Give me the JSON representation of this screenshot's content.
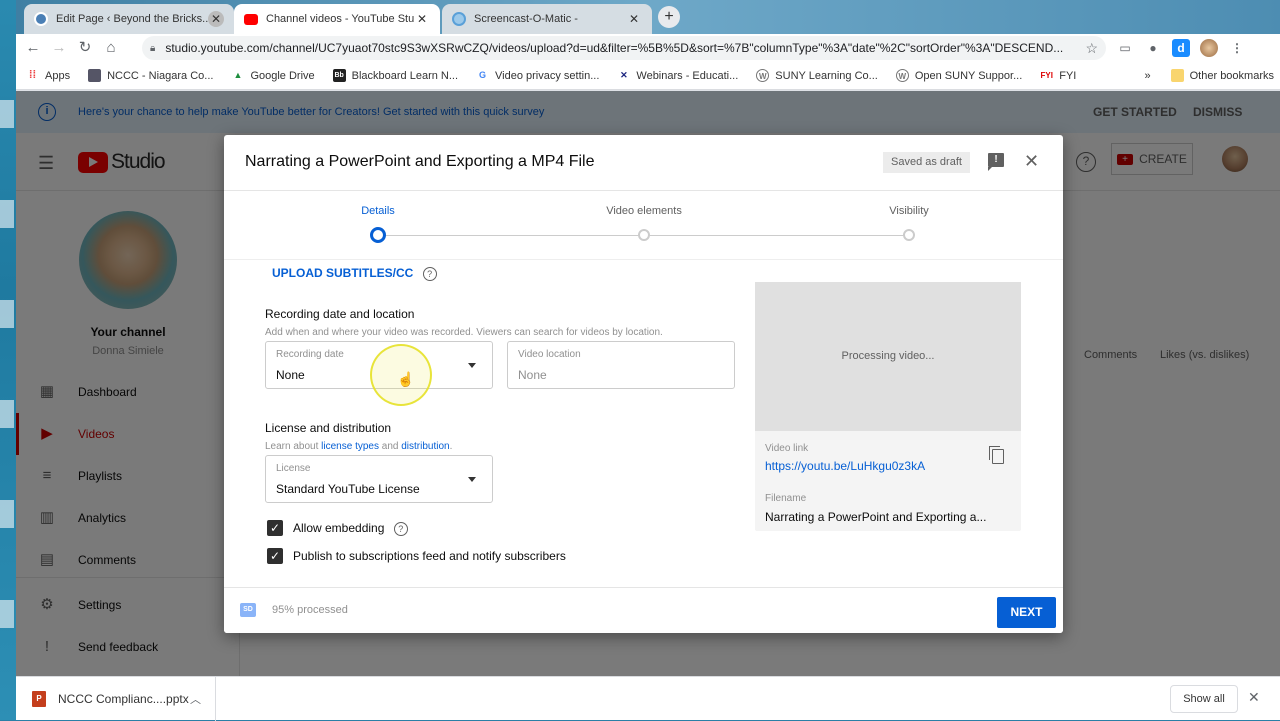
{
  "browser": {
    "tabs": [
      {
        "label": "Edit Page ‹ Beyond the Bricks... N",
        "icon": "wordpress-icon",
        "active": false
      },
      {
        "label": "Channel videos - YouTube Studio",
        "icon": "youtube-icon",
        "active": true
      },
      {
        "label": "Screencast-O-Matic -",
        "icon": "screencast-icon",
        "active": false
      }
    ],
    "url": "studio.youtube.com/channel/UC7yuaot70stc9S3wXSRwCZQ/videos/upload?d=ud&filter=%5B%5D&sort=%7B\"columnType\"%3A\"date\"%2C\"sortOrder\"%3A\"DESCEND...",
    "bookmarks": [
      {
        "label": "Apps",
        "icon": "apps-grid-icon"
      },
      {
        "label": "NCCC - Niagara Co...",
        "icon": "nccc-icon"
      },
      {
        "label": "Google Drive",
        "icon": "google-drive-icon"
      },
      {
        "label": "Blackboard Learn N...",
        "icon": "blackboard-icon"
      },
      {
        "label": "Video privacy settin...",
        "icon": "google-icon"
      },
      {
        "label": "Webinars - Educati...",
        "icon": "webinars-icon"
      },
      {
        "label": "SUNY Learning Co...",
        "icon": "wordpress-icon"
      },
      {
        "label": "Open SUNY Suppor...",
        "icon": "wordpress-icon"
      },
      {
        "label": "FYI",
        "icon": "fyi-icon"
      }
    ],
    "other_bookmarks": "Other bookmarks",
    "overflow": "»"
  },
  "banner": {
    "text": "Here's your chance to help make YouTube better for Creators! Get started with this quick survey",
    "get_started": "GET STARTED",
    "dismiss": "DISMISS"
  },
  "header": {
    "logo_text": "Studio",
    "create_label": "CREATE"
  },
  "sidebar": {
    "channel_title": "Your channel",
    "channel_name": "Donna Simiele",
    "items": [
      {
        "label": "Dashboard",
        "icon": "dashboard-icon",
        "active": false
      },
      {
        "label": "Videos",
        "icon": "videos-icon",
        "active": true
      },
      {
        "label": "Playlists",
        "icon": "playlists-icon",
        "active": false
      },
      {
        "label": "Analytics",
        "icon": "analytics-icon",
        "active": false
      },
      {
        "label": "Comments",
        "icon": "comments-icon",
        "active": false
      },
      {
        "label": "Settings",
        "icon": "gear-icon",
        "active": false
      },
      {
        "label": "Send feedback",
        "icon": "feedback-icon",
        "active": false
      }
    ]
  },
  "background_table": {
    "columns": [
      "Comments",
      "Likes (vs. dislikes)"
    ]
  },
  "dialog": {
    "title": "Narrating a PowerPoint and Exporting a MP4 File",
    "draft_status": "Saved as draft",
    "steps": [
      {
        "label": "Details",
        "active": true
      },
      {
        "label": "Video elements",
        "active": false
      },
      {
        "label": "Visibility",
        "active": false
      }
    ],
    "upload_subtitles": "UPLOAD SUBTITLES/CC",
    "recording": {
      "title": "Recording date and location",
      "description": "Add when and where your video was recorded. Viewers can search for videos by location.",
      "date_label": "Recording date",
      "date_value": "None",
      "location_label": "Video location",
      "location_value": "None"
    },
    "license": {
      "title": "License and distribution",
      "desc_prefix": "Learn about ",
      "link1": "license types",
      "desc_mid": " and ",
      "link2": "distribution",
      "desc_suffix": ".",
      "field_label": "License",
      "field_value": "Standard YouTube License"
    },
    "checkboxes": [
      {
        "label": "Allow embedding",
        "checked": true
      },
      {
        "label": "Publish to subscriptions feed and notify subscribers",
        "checked": true
      }
    ],
    "preview": {
      "status": "Processing video...",
      "link_label": "Video link",
      "link": "https://youtu.be/LuHkgu0z3kA",
      "filename_label": "Filename",
      "filename": "Narrating a PowerPoint and Exporting a..."
    },
    "footer": {
      "quality_badge": "SD",
      "progress_text": "95% processed",
      "progress_percent": 95,
      "next_label": "NEXT"
    }
  },
  "downloads": {
    "file": "NCCC Complianc....pptx",
    "show_all": "Show all"
  }
}
